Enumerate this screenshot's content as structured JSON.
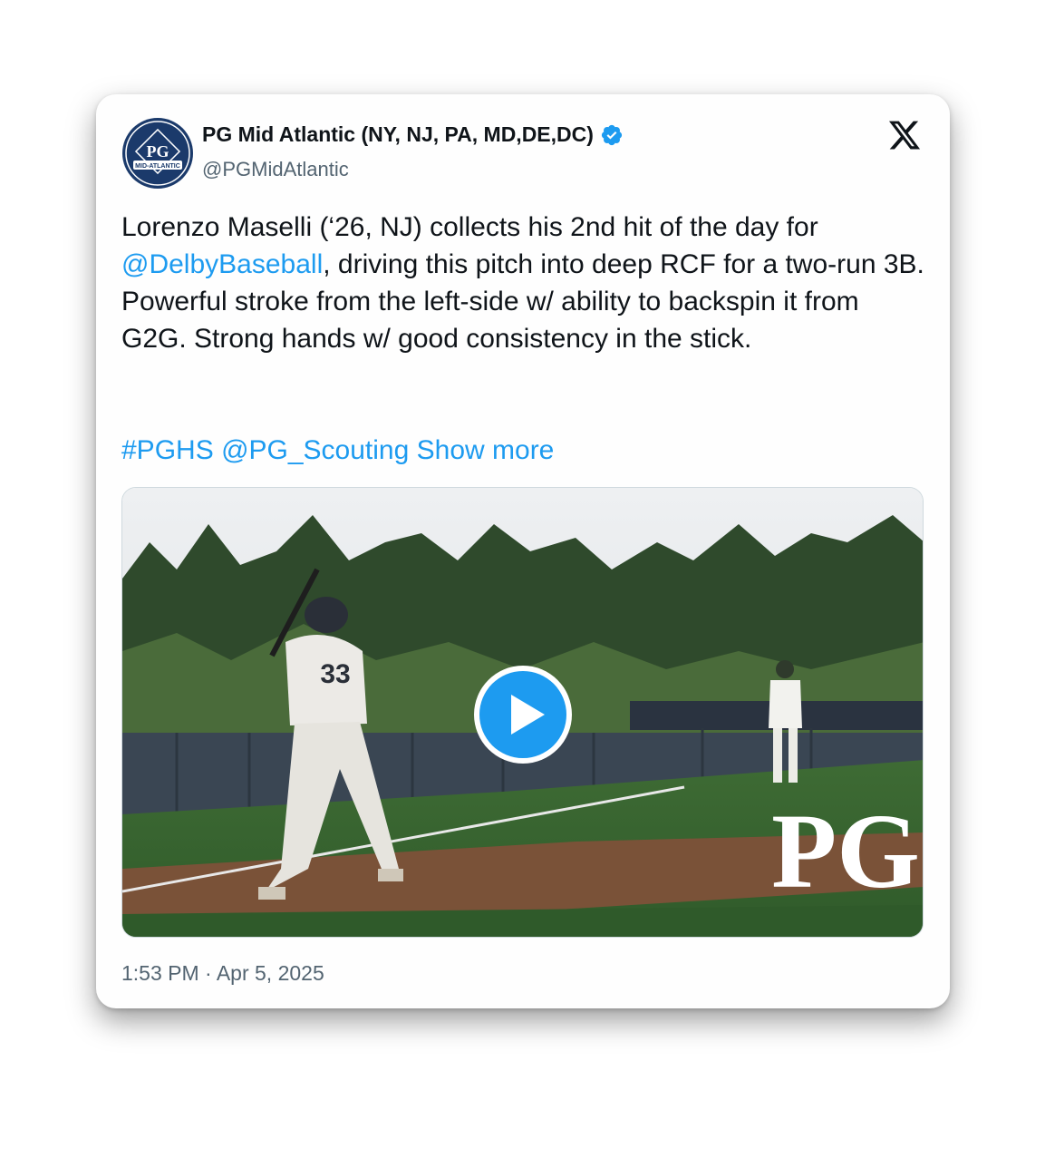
{
  "tweet": {
    "author_name": "PG Mid Atlantic (NY, NJ, PA, MD,DE,DC)",
    "handle": "@PGMidAtlantic",
    "verified_icon": "verified-badge-icon",
    "platform_icon": "x-logo-icon",
    "avatar_text": "PG",
    "avatar_banner": "MID-ATLANTIC",
    "text_segments": {
      "line_start": "Lorenzo Maselli (‘26, NJ) collects his 2nd hit of the day for ",
      "mention_1": "@DelbyBaseball",
      "line_rest": ", driving this pitch into deep RCF for a two-run 3B. Powerful stroke from the left-side w/ ability to backspin it from G2G. Strong hands w/ good consistency in the stick."
    },
    "hashtag": "#PGHS",
    "mention_2": "@PG_Scouting",
    "show_more": "Show more",
    "jersey_number": "33",
    "video_watermark": "PG",
    "timestamp": "1:53 PM · Apr 5, 2025"
  },
  "colors": {
    "link": "#1d9bf0",
    "text": "#0f1419",
    "secondary": "#536471",
    "avatar_bg": "#1b3a6b"
  }
}
